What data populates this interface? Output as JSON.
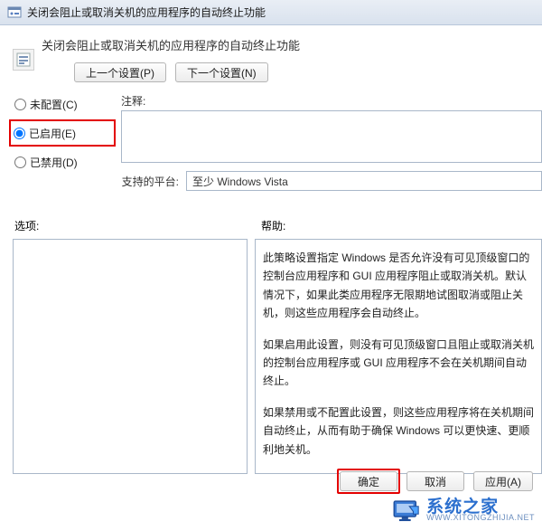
{
  "window": {
    "title": "关闭会阻止或取消关机的应用程序的自动终止功能"
  },
  "header": {
    "title": "关闭会阻止或取消关机的应用程序的自动终止功能",
    "nav_prev": "上一个设置(P)",
    "nav_next": "下一个设置(N)"
  },
  "radios": {
    "not_configured": "未配置(C)",
    "enabled": "已启用(E)",
    "disabled": "已禁用(D)",
    "selected": "enabled"
  },
  "labels": {
    "comment": "注释:",
    "supported_platform": "支持的平台:",
    "options": "选项:",
    "help": "帮助:"
  },
  "platform": {
    "value": "至少 Windows Vista"
  },
  "help": {
    "p1": "此策略设置指定 Windows 是否允许没有可见顶级窗口的控制台应用程序和 GUI 应用程序阻止或取消关机。默认情况下，如果此类应用程序无限期地试图取消或阻止关机，则这些应用程序会自动终止。",
    "p2": "如果启用此设置，则没有可见顶级窗口且阻止或取消关机的控制台应用程序或 GUI 应用程序不会在关机期间自动终止。",
    "p3": "如果禁用或不配置此设置，则这些应用程序将在关机期间自动终止，从而有助于确保 Windows 可以更快速、更顺利地关机。"
  },
  "footer": {
    "ok": "确定",
    "cancel": "取消",
    "apply": "应用(A)"
  },
  "watermark": {
    "name": "系统之家",
    "url": "WWW.XITONGZHIJIA.NET"
  }
}
